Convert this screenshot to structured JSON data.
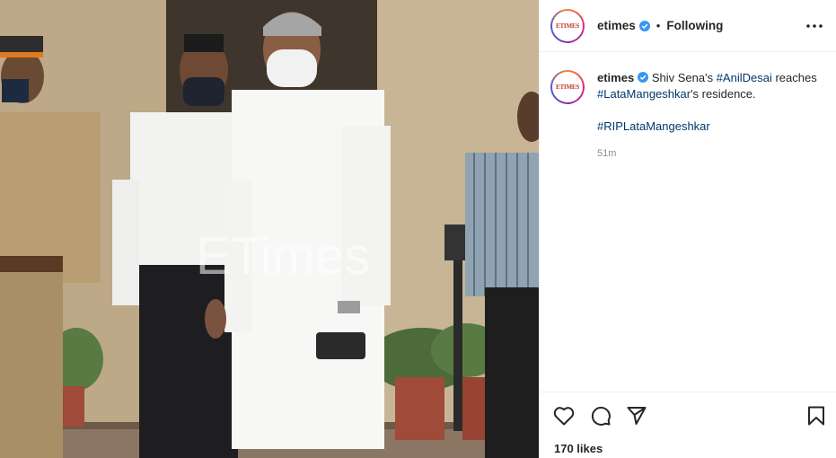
{
  "post": {
    "image_watermark": "ETimes",
    "image_alt": "Men in white clothes standing outside a residence with police officers"
  },
  "header": {
    "avatar_text": "ETIMES",
    "username": "etimes",
    "separator": "•",
    "follow_status": "Following"
  },
  "caption": {
    "avatar_text": "ETIMES",
    "username": "etimes",
    "text_1": "Shiv Sena's ",
    "hashtag_1": "#AnilDesai",
    "text_2": " reaches ",
    "hashtag_2": "#LataMangeshkar",
    "text_3": "'s residence.",
    "hashtag_3": "#RIPLataMangeshkar",
    "timestamp": "51m"
  },
  "engagement": {
    "likes": "170 likes"
  },
  "colors": {
    "verified": "#3897f0",
    "link": "#00376b",
    "text": "#262626",
    "muted": "#8e8e8e"
  },
  "icons": [
    "verified-icon",
    "more-icon",
    "heart-icon",
    "comment-icon",
    "share-icon",
    "bookmark-icon"
  ]
}
